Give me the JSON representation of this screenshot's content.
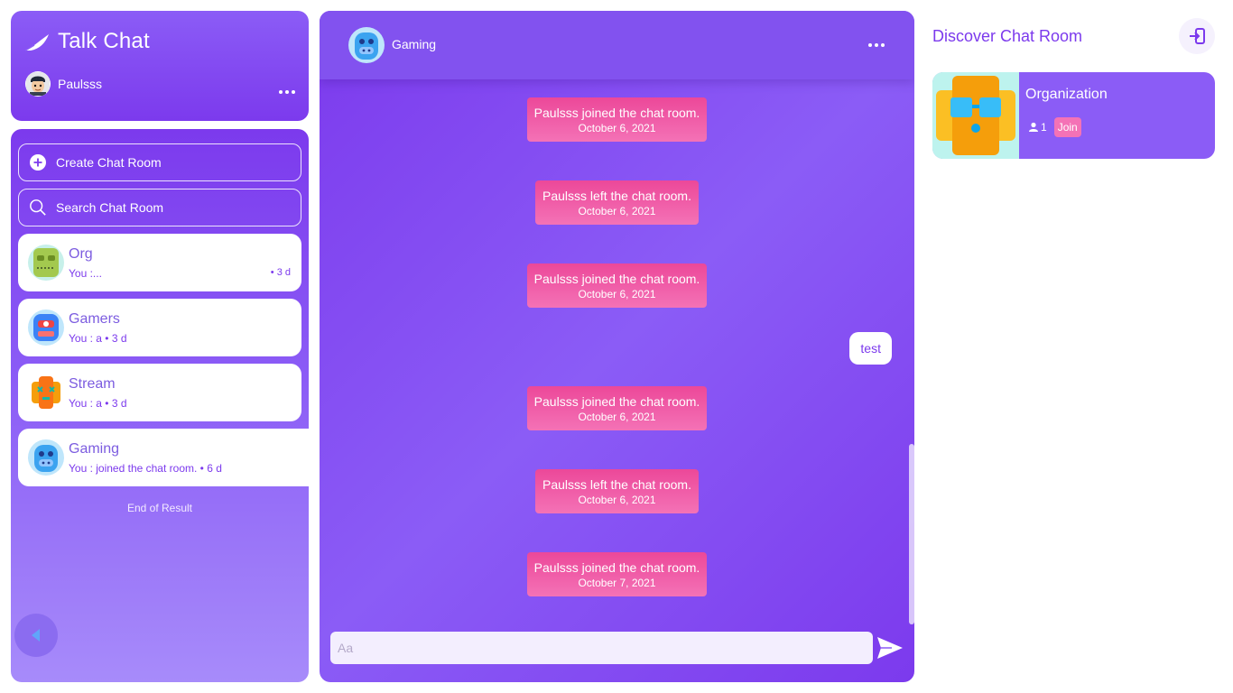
{
  "app": {
    "title": "Talk Chat",
    "user_name": "Paulsss"
  },
  "sidebar": {
    "create_label": "Create Chat Room",
    "search_label": "Search Chat Room",
    "rooms": [
      {
        "name": "Org",
        "last_message": "You :...",
        "time": "• 3 d",
        "avatar_color": "#a3c94f"
      },
      {
        "name": "Gamers",
        "last_message": "You : a",
        "time": "• 3 d",
        "avatar_color": "#3b82f6"
      },
      {
        "name": "Stream",
        "last_message": "You : a",
        "time": "• 3 d",
        "avatar_color": "#f59e0b"
      },
      {
        "name": "Gaming",
        "last_message": "You : joined the chat room.",
        "time": "• 6 d",
        "avatar_color": "#3ba3f0",
        "active": true
      }
    ],
    "end_text": "End of Result"
  },
  "chat": {
    "room_name": "Gaming",
    "messages": [
      {
        "type": "system",
        "text": "Paulsss joined the chat room.",
        "date": "October 6, 2021"
      },
      {
        "type": "system",
        "text": "Paulsss left the chat room.",
        "date": "October 6, 2021"
      },
      {
        "type": "system",
        "text": "Paulsss joined the chat room.",
        "date": "October 6, 2021"
      },
      {
        "type": "own",
        "text": "test"
      },
      {
        "type": "system",
        "text": "Paulsss joined the chat room.",
        "date": "October 6, 2021"
      },
      {
        "type": "system",
        "text": "Paulsss left the chat room.",
        "date": "October 6, 2021"
      },
      {
        "type": "system",
        "text": "Paulsss joined the chat room.",
        "date": "October 7, 2021"
      }
    ],
    "composer_placeholder": "Aa"
  },
  "discover": {
    "title": "Discover Chat Room",
    "rooms": [
      {
        "name": "Organization",
        "members": "1",
        "join_label": "Join"
      }
    ]
  },
  "colors": {
    "accent": "#7c3aed",
    "pink": "#ec4899"
  }
}
